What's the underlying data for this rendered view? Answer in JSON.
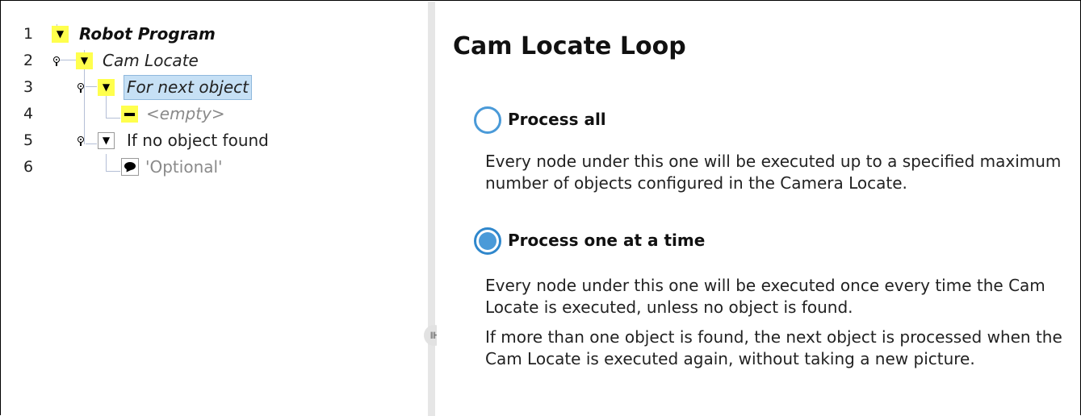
{
  "tree": {
    "rows": [
      {
        "line": "1",
        "label": "Robot Program"
      },
      {
        "line": "2",
        "label": "Cam Locate"
      },
      {
        "line": "3",
        "label": "For next object"
      },
      {
        "line": "4",
        "label": "<empty>"
      },
      {
        "line": "5",
        "label": "If no object found"
      },
      {
        "line": "6",
        "label": "'Optional'"
      }
    ]
  },
  "splitter": {
    "handle_glyph": "⊪"
  },
  "panel": {
    "title": "Cam Locate Loop",
    "options": [
      {
        "label": "Process all",
        "selected": false,
        "description": [
          "Every node under this one will be executed up to a specified maximum number of objects configured in the Camera Locate."
        ]
      },
      {
        "label": "Process one at a time",
        "selected": true,
        "description": [
          "Every node under this one will be executed once every time the Cam Locate is executed, unless no object is found.",
          "If more than one object is found, the next object is processed when the Cam Locate is executed again, without taking a new picture."
        ]
      }
    ]
  },
  "colors": {
    "accent": "#4a9ad8",
    "selection": "#c6e0f5",
    "toggle": "#ffff4d"
  },
  "icons": [
    "expand-toggle-icon",
    "drag-handle-icon",
    "empty-node-icon",
    "comment-icon",
    "splitter-handle-icon"
  ]
}
